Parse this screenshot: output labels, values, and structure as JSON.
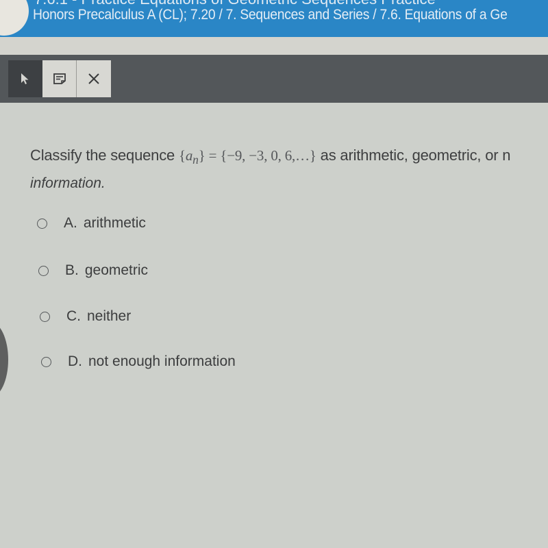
{
  "header": {
    "title_partial": "7.6.1 - Practice Equations of Geometric Sequences Practice",
    "breadcrumb": "Honors Precalculus A (CL); 7.20 / 7. Sequences and Series / 7.6. Equations of a Ge"
  },
  "toolbar": {
    "pointer_icon": "cursor-arrow-icon",
    "note_icon": "note-icon",
    "close_icon": "close-icon"
  },
  "question": {
    "text_before": "Classify the sequence ",
    "math_lhs_open": "{",
    "math_var": "a",
    "math_sub": "n",
    "math_lhs_close": "}",
    "math_eq": " = ",
    "math_rhs": "{−9, −3, 0, 6,…}",
    "text_after": " as arithmetic, geometric, or n",
    "text_cont": "information."
  },
  "options": [
    {
      "letter": "A.",
      "label": "arithmetic",
      "selected": false
    },
    {
      "letter": "B.",
      "label": "geometric",
      "selected": false
    },
    {
      "letter": "C.",
      "label": "neither",
      "selected": false
    },
    {
      "letter": "D.",
      "label": "not enough information",
      "selected": false
    }
  ]
}
